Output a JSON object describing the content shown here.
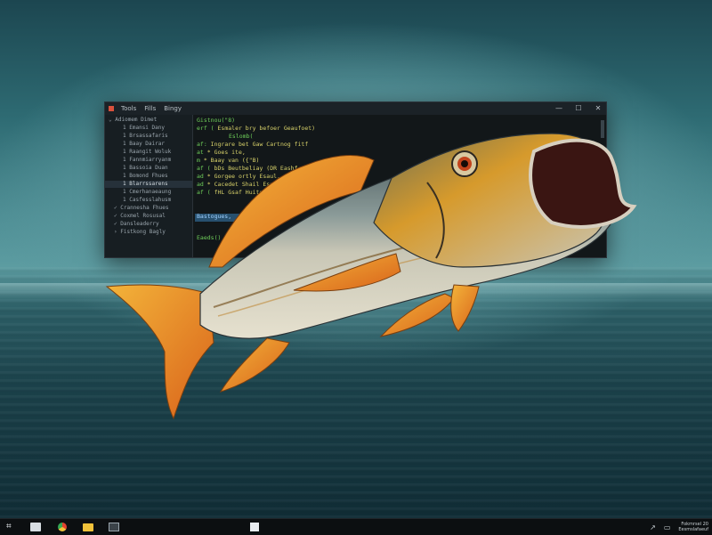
{
  "window": {
    "menu": [
      "Tools",
      "Fills",
      "Bingy"
    ],
    "controls": {
      "minimize": "—",
      "maximize": "☐",
      "close": "✕"
    }
  },
  "explorer": {
    "items": [
      {
        "glyph": "⌄",
        "label": "Adiomem Dimet"
      },
      {
        "glyph": "1",
        "label": "Emansi Dany"
      },
      {
        "glyph": "1",
        "label": "Brsassafaris"
      },
      {
        "glyph": "1",
        "label": "Baay Dairar"
      },
      {
        "glyph": "1",
        "label": "Raangit Woluk"
      },
      {
        "glyph": "1",
        "label": "Fannmiarryanm"
      },
      {
        "glyph": "1",
        "label": "Bassoia Duan"
      },
      {
        "glyph": "1",
        "label": "Bomond Fhues"
      },
      {
        "glyph": "1",
        "label": "Blarrssarens"
      },
      {
        "glyph": "1",
        "label": "Cmerhanaeaung"
      },
      {
        "glyph": "1",
        "label": "Casfesslahusm"
      },
      {
        "glyph": "✓",
        "label": "Crannesha Fhues"
      },
      {
        "glyph": "✓",
        "label": "Coxmel Rosusal"
      },
      {
        "glyph": "✓",
        "label": "Dansleaderry"
      },
      {
        "glyph": "›",
        "label": "Fistkong Bagly"
      }
    ]
  },
  "editor": {
    "lines": [
      {
        "prefix": "",
        "text": "Gistnou(\"8)"
      },
      {
        "prefix": "erf (",
        "text": "Esmaler bry befoer Geaufoet)"
      },
      {
        "prefix": "",
        "text": "Eslomb("
      },
      {
        "prefix": "af:",
        "text": "Ingrare bet Gaw Cartnog fitf"
      },
      {
        "prefix": "at ",
        "text": "*  Goes ite,"
      },
      {
        "prefix": "m  ",
        "text": "* Baay van ({\"B)"
      },
      {
        "prefix": "af (",
        "text": "bDs Beutbeliay  (DR Eashf"
      },
      {
        "prefix": "ad ",
        "text": "*  Gorgee  ortly Esaul,"
      },
      {
        "prefix": "ad ",
        "text": "*  Cacedet  Shail Esuayt,"
      },
      {
        "prefix": "af (",
        "text": "fHL Gsaf Huits ieutf"
      },
      {
        "prefix": "",
        "text": ""
      },
      {
        "prefix": "",
        "text": "Bastogues,"
      },
      {
        "prefix": "",
        "text": ""
      },
      {
        "prefix": "",
        "text": ""
      },
      {
        "prefix": "",
        "text": "Eaeds()"
      }
    ]
  },
  "taskbar": {
    "apps": [
      "start-icon",
      "mail-icon",
      "chrome-icon",
      "folder-icon",
      "photos-icon"
    ],
    "center_app": "calculator-icon",
    "tray": {
      "signal": "↗",
      "battery": "▭",
      "clock_time": "Fokmrsel 20",
      "clock_date": "Eesmslafaeuf"
    }
  },
  "colors": {
    "code_green": "#6fcf5a",
    "code_yellow": "#d8d26a",
    "code_prefix": "#8a9aa3",
    "chrome_red": "#e0432f",
    "folder_yellow": "#f0c23a"
  }
}
